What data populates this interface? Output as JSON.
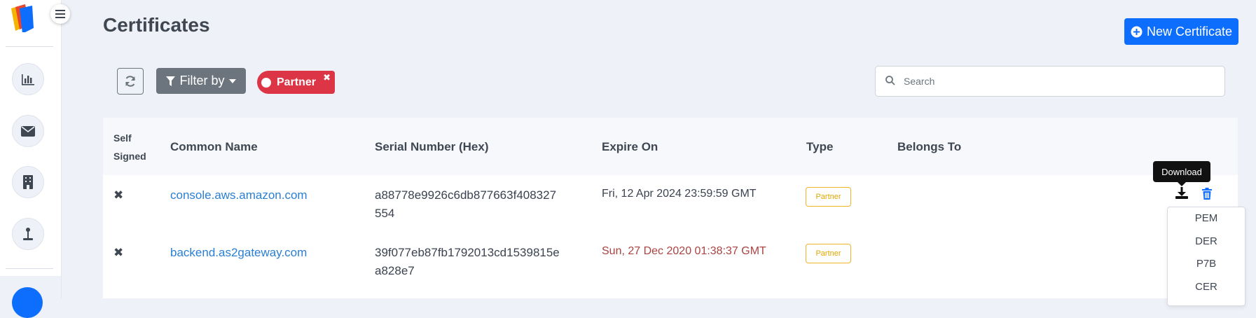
{
  "page": {
    "title": "Certificates"
  },
  "header": {
    "new_button_label": "New Certificate"
  },
  "toolbar": {
    "filter_label": "Filter by",
    "active_filter": "Partner",
    "filter_remove": "✖",
    "search_placeholder": "Search"
  },
  "sidebar": {
    "items": [
      {
        "icon": "chart-bar-icon"
      },
      {
        "icon": "envelope-icon"
      },
      {
        "icon": "building-icon"
      },
      {
        "icon": "anchor-icon"
      }
    ]
  },
  "table": {
    "headers": {
      "self_signed_line1": "Self",
      "self_signed_line2": "Signed",
      "common_name": "Common Name",
      "serial": "Serial Number (Hex)",
      "expire": "Expire On",
      "type": "Type",
      "belongs_to": "Belongs To"
    },
    "rows": [
      {
        "self_signed": "✖",
        "common_name": "console.aws.amazon.com",
        "serial_line1": "a88778e9926c6db877663f408327",
        "serial_line2": "554",
        "expire_on": "Fri, 12 Apr 2024 23:59:59 GMT",
        "type": "Partner",
        "belongs_to": ""
      },
      {
        "self_signed": "✖",
        "common_name": "backend.as2gateway.com",
        "serial_line1": "39f077eb87fb1792013cd1539815e",
        "serial_line2": "a828e7",
        "expire_on": "Sun, 27 Dec 2020 01:38:37 GMT",
        "type": "Partner",
        "belongs_to": ""
      }
    ]
  },
  "actions": {
    "tooltip": "Download",
    "download_formats": [
      "PEM",
      "DER",
      "P7B",
      "CER"
    ]
  },
  "colors": {
    "primary": "#0d6efd",
    "danger": "#dc3545",
    "secondary": "#6c757d",
    "warning": "#f0b429",
    "link": "#2a7fd4"
  }
}
